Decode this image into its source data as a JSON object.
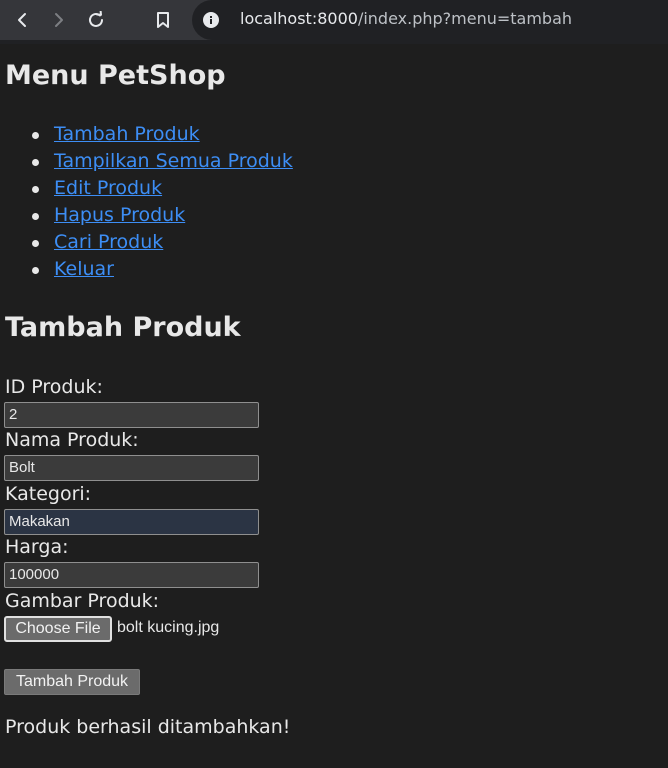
{
  "browser": {
    "url_host": "localhost:8000",
    "url_path": "/index.php?menu=tambah",
    "icons": [
      "back-icon",
      "forward-icon",
      "reload-icon",
      "bookmark-icon",
      "info-icon"
    ]
  },
  "page": {
    "menu_title": "Menu PetShop",
    "menu_items": [
      {
        "label": "Tambah Produk"
      },
      {
        "label": "Tampilkan Semua Produk"
      },
      {
        "label": "Edit Produk"
      },
      {
        "label": "Hapus Produk"
      },
      {
        "label": "Cari Produk"
      },
      {
        "label": "Keluar"
      }
    ],
    "section_title": "Tambah Produk",
    "form": {
      "id": {
        "label": "ID Produk:",
        "value": "2"
      },
      "nama": {
        "label": "Nama Produk:",
        "value": "Bolt"
      },
      "kategori": {
        "label": "Kategori:",
        "value": "Makakan"
      },
      "harga": {
        "label": "Harga:",
        "value": "100000"
      },
      "gambar": {
        "label": "Gambar Produk:",
        "button": "Choose File",
        "file_name": "bolt kucing.jpg"
      },
      "submit": "Tambah Produk"
    },
    "success_message": "Produk berhasil ditambahkan!"
  },
  "colors": {
    "background": "#1e1e1e",
    "link": "#3d8ef5",
    "toolbar": "#35363a",
    "address_bar": "#202124"
  }
}
